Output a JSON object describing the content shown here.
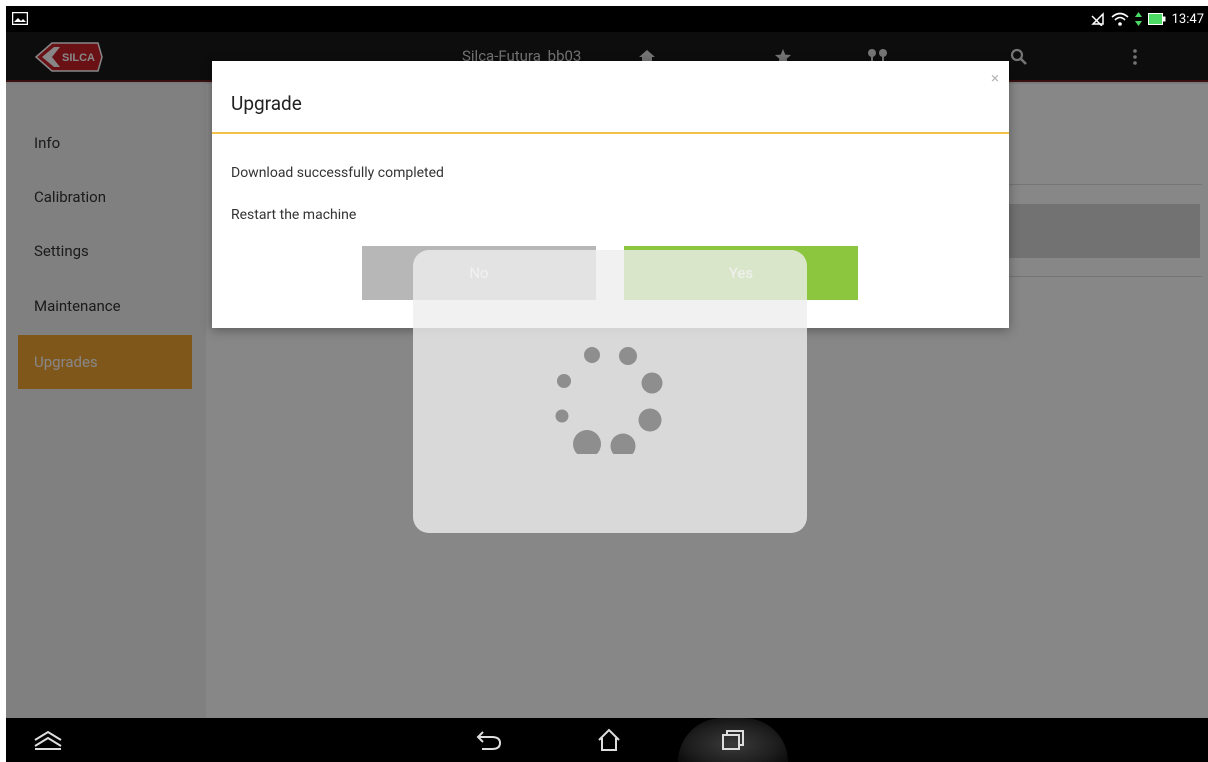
{
  "status_bar": {
    "time": "13:47",
    "icons": [
      "gallery-icon",
      "no-signal-icon",
      "wifi-icon",
      "data-arrows-icon",
      "battery-icon"
    ]
  },
  "app_bar": {
    "title": "Silca-Futura_bb03",
    "logo_text": "SILCA",
    "actions": [
      "home-icon",
      "star-icon",
      "keys-icon",
      "search-icon",
      "overflow-menu-icon"
    ]
  },
  "sidebar": {
    "items": [
      {
        "label": "Info",
        "active": false
      },
      {
        "label": "Calibration",
        "active": false
      },
      {
        "label": "Settings",
        "active": false
      },
      {
        "label": "Maintenance",
        "active": false
      },
      {
        "label": "Upgrades",
        "active": true
      }
    ]
  },
  "dialog": {
    "title": "Upgrade",
    "close_symbol": "×",
    "message_1": "Download successfully completed",
    "message_2": "Restart the machine",
    "no_label": "No",
    "yes_label": "Yes"
  },
  "progress": {
    "indicator": "spinner"
  },
  "nav_bar": {
    "buttons": [
      "recent-apps-up-icon",
      "back-icon",
      "home-nav-icon",
      "recents-icon"
    ]
  },
  "colors": {
    "accent_orange": "#f2a532",
    "yes_green": "#8cc63f",
    "no_gray": "#b7b7b7",
    "divider_yellow": "#f1c14a",
    "silca_red": "#c8202a"
  }
}
